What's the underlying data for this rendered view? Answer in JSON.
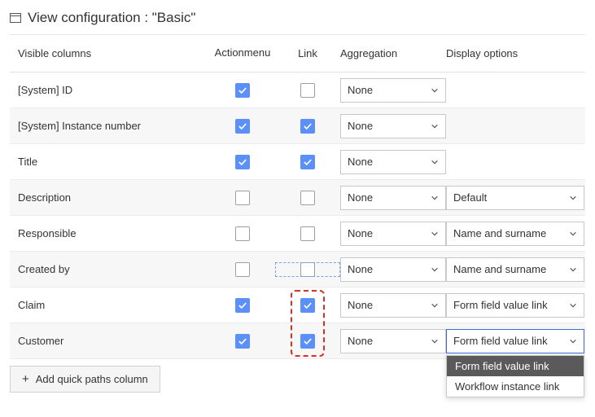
{
  "header": {
    "title": "View configuration : \"Basic\""
  },
  "columns": {
    "visible": "Visible columns",
    "action_line1": "Action",
    "action_line2": "menu",
    "link": "Link",
    "aggregation": "Aggregation",
    "display": "Display options"
  },
  "aggregation_default": "None",
  "rows": [
    {
      "label": "[System] ID",
      "action": true,
      "link": false,
      "aggregation": "None",
      "display": null
    },
    {
      "label": "[System] Instance number",
      "action": true,
      "link": true,
      "aggregation": "None",
      "display": null
    },
    {
      "label": "Title",
      "action": true,
      "link": true,
      "aggregation": "None",
      "display": null
    },
    {
      "label": "Description",
      "action": false,
      "link": false,
      "aggregation": "None",
      "display": "Default"
    },
    {
      "label": "Responsible",
      "action": false,
      "link": false,
      "aggregation": "None",
      "display": "Name and surname"
    },
    {
      "label": "Created by",
      "action": false,
      "link": false,
      "aggregation": "None",
      "display": "Name and surname"
    },
    {
      "label": "Claim",
      "action": true,
      "link": true,
      "aggregation": "None",
      "display": "Form field value link"
    },
    {
      "label": "Customer",
      "action": true,
      "link": true,
      "aggregation": "None",
      "display": "Form field value link"
    }
  ],
  "footer": {
    "add_button": "Add quick paths column"
  },
  "dropdown": {
    "options": [
      "Form field value link",
      "Workflow instance link"
    ],
    "selected": "Form field value link"
  }
}
